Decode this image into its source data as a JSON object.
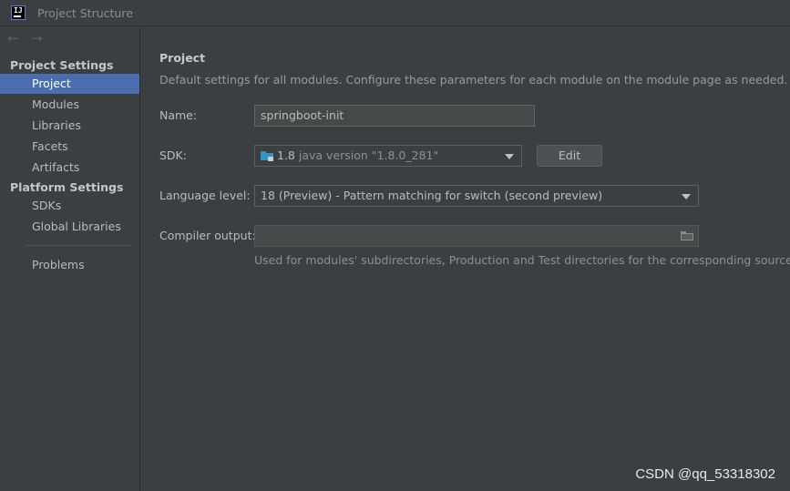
{
  "window": {
    "title": "Project Structure",
    "logo_text": "IJ"
  },
  "nav": {
    "back_glyph": "←",
    "forward_glyph": "→"
  },
  "sidebar": {
    "project_settings_title": "Project Settings",
    "project_settings_items": [
      {
        "label": "Project",
        "selected": true
      },
      {
        "label": "Modules",
        "selected": false
      },
      {
        "label": "Libraries",
        "selected": false
      },
      {
        "label": "Facets",
        "selected": false
      },
      {
        "label": "Artifacts",
        "selected": false
      }
    ],
    "platform_settings_title": "Platform Settings",
    "platform_settings_items": [
      {
        "label": "SDKs"
      },
      {
        "label": "Global Libraries"
      }
    ],
    "problems_label": "Problems"
  },
  "main": {
    "title": "Project",
    "description": "Default settings for all modules. Configure these parameters for each module on the module page as needed.",
    "name_label": "Name:",
    "name_value": "springboot-init",
    "sdk_label": "SDK:",
    "sdk_value": "1.8",
    "sdk_detail": "java version \"1.8.0_281\"",
    "sdk_icon": "sdk-folder-icon",
    "edit_label": "Edit",
    "language_level_label": "Language level:",
    "language_level_value": "18 (Preview) - Pattern matching for switch (second preview)",
    "compiler_output_label": "Compiler output:",
    "compiler_output_value": "",
    "compiler_output_hint": "Used for modules' subdirectories, Production and Test directories for the corresponding sources."
  },
  "watermark": "CSDN @qq_53318302",
  "colors": {
    "background": "#3c3f41",
    "selection": "#4b6eaf",
    "text": "#bbbbbb"
  }
}
